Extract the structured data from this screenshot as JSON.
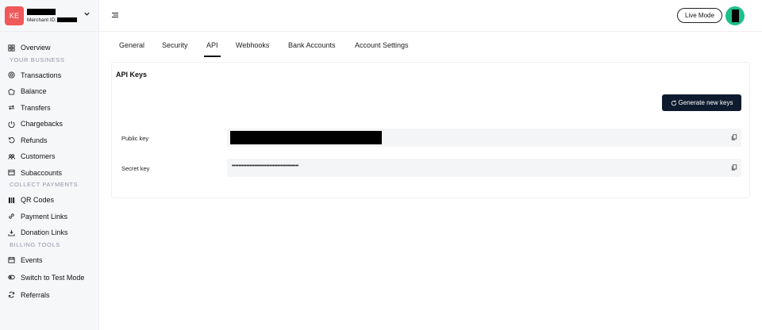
{
  "brand": {
    "initials": "KE",
    "merchant_label": "Merchant ID:"
  },
  "sidebar": {
    "items_top": [
      {
        "label": "Overview",
        "icon": "grid-icon"
      }
    ],
    "section_business": "YOUR BUSINESS",
    "items_business": [
      {
        "label": "Transactions",
        "icon": "coins-icon"
      },
      {
        "label": "Balance",
        "icon": "wallet-icon"
      },
      {
        "label": "Transfers",
        "icon": "transfer-icon"
      },
      {
        "label": "Chargebacks",
        "icon": "chargeback-icon"
      },
      {
        "label": "Refunds",
        "icon": "refund-icon"
      },
      {
        "label": "Customers",
        "icon": "users-icon"
      },
      {
        "label": "Subaccounts",
        "icon": "subaccount-icon"
      }
    ],
    "section_collect": "COLLECT PAYMENTS",
    "items_collect": [
      {
        "label": "QR Codes",
        "icon": "qr-icon"
      },
      {
        "label": "Payment Links",
        "icon": "link-icon"
      },
      {
        "label": "Donation Links",
        "icon": "donation-icon"
      }
    ],
    "section_billing": "BILLING TOOLS",
    "items_billing": [
      {
        "label": "Events",
        "icon": "calendar-icon"
      },
      {
        "label": "Switch to Test Mode",
        "icon": "toggle-icon"
      },
      {
        "label": "Referrals",
        "icon": "referral-icon"
      }
    ]
  },
  "header": {
    "live_mode": "Live Mode"
  },
  "tabs": [
    "General",
    "Security",
    "API",
    "Webhooks",
    "Bank Accounts",
    "Account Settings"
  ],
  "active_tab": "API",
  "api": {
    "title": "API Keys",
    "generate_label": "Generate new keys",
    "public_label": "Public key",
    "secret_label": "Secret key",
    "secret_masked": "•••••••••••••••••••••••••••••••••••••••••"
  }
}
